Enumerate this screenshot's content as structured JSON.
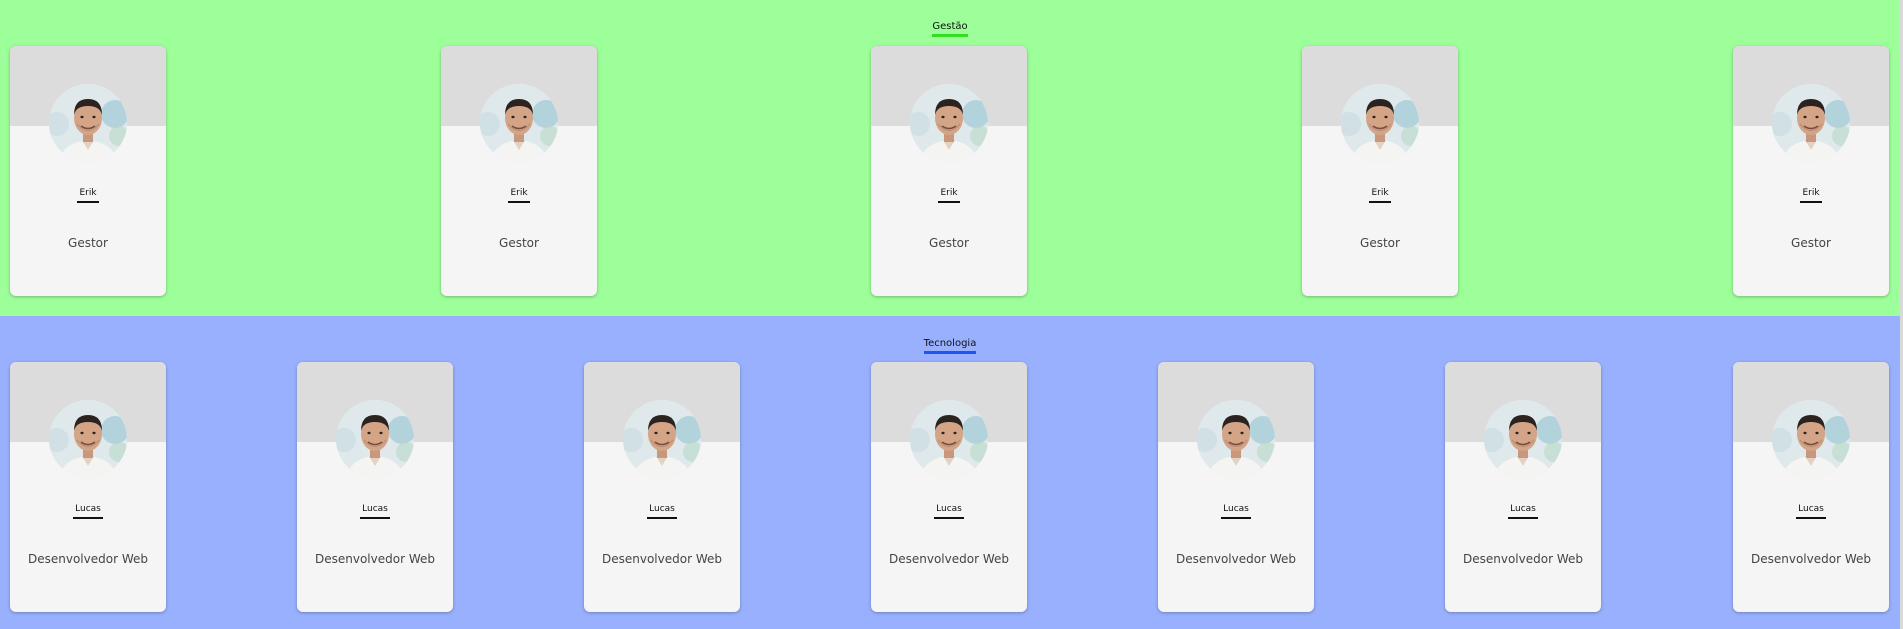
{
  "colors": {
    "gestao_bg": "#9cff99",
    "tecnologia_bg": "#99b0ff",
    "gestao_accent": "#33dd22",
    "tecnologia_accent": "#2255ee",
    "card_bg": "#f5f5f5",
    "card_header": "#dcdcdc"
  },
  "sections": [
    {
      "title": "Gestão",
      "members": [
        {
          "name": "Erik",
          "role": "Gestor",
          "photo": "avatar-photo"
        },
        {
          "name": "Erik",
          "role": "Gestor",
          "photo": "avatar-photo"
        },
        {
          "name": "Erik",
          "role": "Gestor",
          "photo": "avatar-photo"
        },
        {
          "name": "Erik",
          "role": "Gestor",
          "photo": "avatar-photo"
        },
        {
          "name": "Erik",
          "role": "Gestor",
          "photo": "avatar-photo"
        }
      ]
    },
    {
      "title": "Tecnologia",
      "members": [
        {
          "name": "Lucas",
          "role": "Desenvolvedor Web",
          "photo": "avatar-photo"
        },
        {
          "name": "Lucas",
          "role": "Desenvolvedor Web",
          "photo": "avatar-photo"
        },
        {
          "name": "Lucas",
          "role": "Desenvolvedor Web",
          "photo": "avatar-photo"
        },
        {
          "name": "Lucas",
          "role": "Desenvolvedor Web",
          "photo": "avatar-photo"
        },
        {
          "name": "Lucas",
          "role": "Desenvolvedor Web",
          "photo": "avatar-photo"
        },
        {
          "name": "Lucas",
          "role": "Desenvolvedor Web",
          "photo": "avatar-photo"
        },
        {
          "name": "Lucas",
          "role": "Desenvolvedor Web",
          "photo": "avatar-photo"
        }
      ]
    }
  ]
}
